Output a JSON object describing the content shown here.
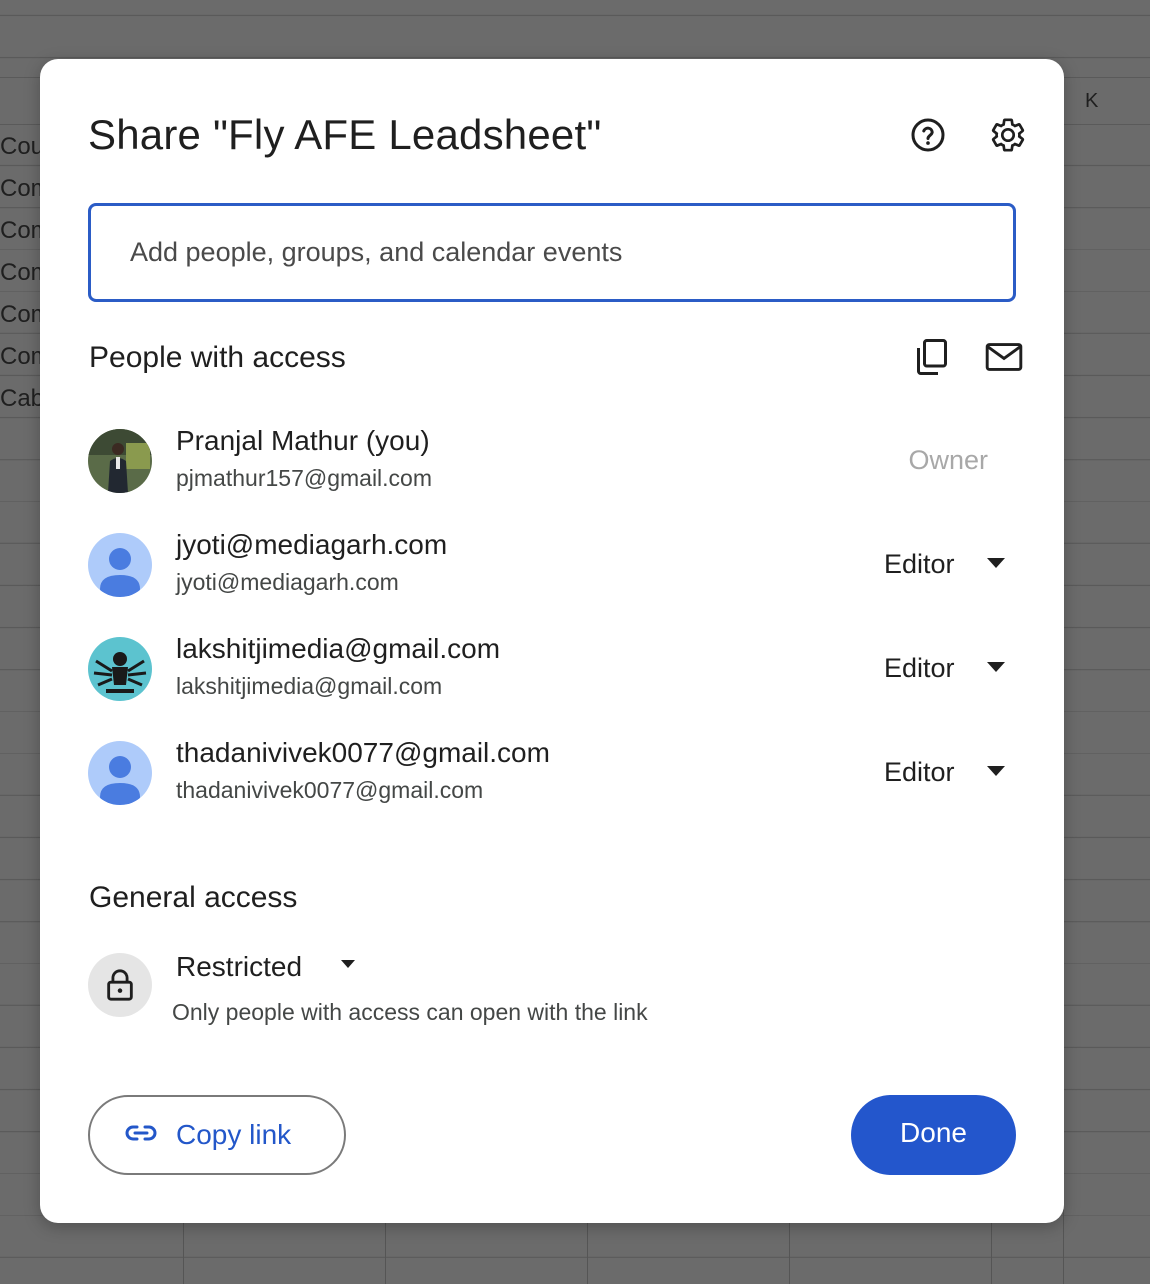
{
  "background": {
    "column_letter": "K",
    "cell_fragments": [
      "Cou",
      "Com",
      "Com",
      "Com",
      "Com",
      "Com",
      "Cabi"
    ]
  },
  "dialog": {
    "title": "Share \"Fly AFE Leadsheet\"",
    "help_icon": "help-circle-icon",
    "settings_icon": "gear-icon",
    "add_input": {
      "placeholder": "Add people, groups, and calendar events",
      "value": ""
    },
    "people_section": {
      "title": "People with access",
      "copy_emails_icon": "copy-icon",
      "email_icon": "mail-icon",
      "people": [
        {
          "name": "Pranjal Mathur (you)",
          "email": "pjmathur157@gmail.com",
          "role": "Owner",
          "avatar": "photo"
        },
        {
          "name": "jyoti@mediagarh.com",
          "email": "jyoti@mediagarh.com",
          "role": "Editor",
          "avatar": "default"
        },
        {
          "name": "lakshitjimedia@gmail.com",
          "email": "lakshitjimedia@gmail.com",
          "role": "Editor",
          "avatar": "photo"
        },
        {
          "name": "thadanivivek0077@gmail.com",
          "email": "thadanivivek0077@gmail.com",
          "role": "Editor",
          "avatar": "default"
        }
      ]
    },
    "general_access": {
      "title": "General access",
      "setting": "Restricted",
      "description": "Only people with access can open with the link",
      "icon": "lock-icon"
    },
    "copy_link_label": "Copy link",
    "done_label": "Done",
    "colors": {
      "accent": "#2356cc",
      "input_border": "#2b5cc6",
      "default_avatar": "#aecbfa",
      "default_avatar_figure": "#4a7ce0"
    }
  }
}
